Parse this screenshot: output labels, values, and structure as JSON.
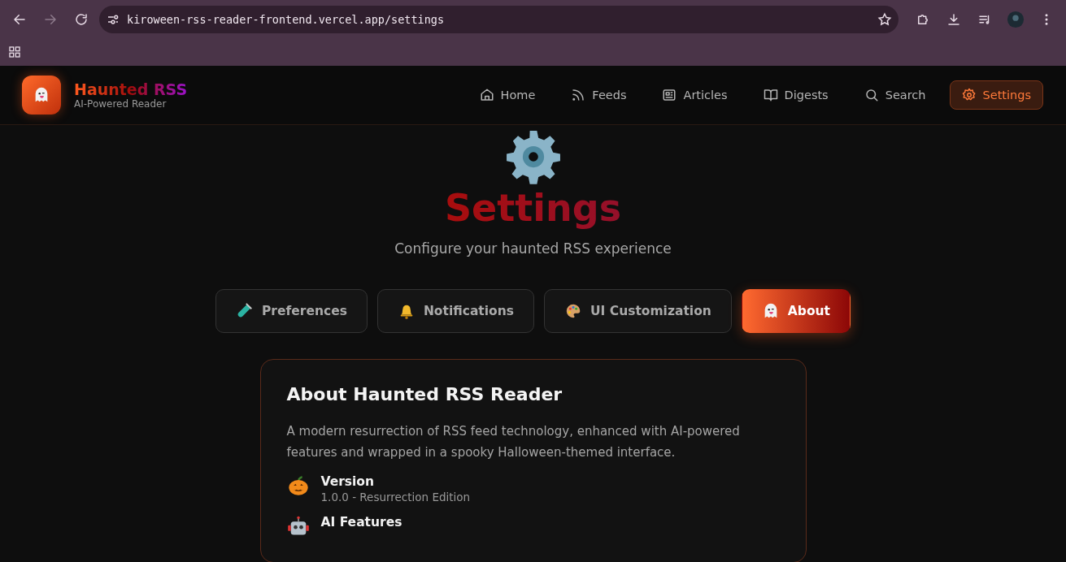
{
  "browser": {
    "url": "kiroween-rss-reader-frontend.vercel.app/settings"
  },
  "header": {
    "brand": "Haunted RSS",
    "tagline": "AI-Powered Reader",
    "nav": [
      {
        "label": "Home",
        "kind": "home",
        "selected": false
      },
      {
        "label": "Feeds",
        "kind": "rss",
        "selected": false
      },
      {
        "label": "Articles",
        "kind": "newspaper",
        "selected": false
      },
      {
        "label": "Digests",
        "kind": "book",
        "selected": false
      },
      {
        "label": "Search",
        "kind": "search",
        "selected": false
      },
      {
        "label": "Settings",
        "kind": "gear",
        "selected": true
      }
    ]
  },
  "page": {
    "title": "Settings",
    "subtitle": "Configure your haunted RSS experience"
  },
  "tabs": [
    {
      "label": "Preferences",
      "kind": "tube",
      "selected": false
    },
    {
      "label": "Notifications",
      "kind": "bell",
      "selected": false
    },
    {
      "label": "UI Customization",
      "kind": "palette",
      "selected": false
    },
    {
      "label": "About",
      "kind": "ghost",
      "selected": true
    }
  ],
  "about": {
    "title": "About Haunted RSS Reader",
    "description": "A modern resurrection of RSS feed technology, enhanced with AI-powered features and wrapped in a spooky Halloween-themed interface.",
    "items": [
      {
        "kind": "pumpkin",
        "label": "Version",
        "detail": "1.0.0 - Resurrection Edition"
      },
      {
        "kind": "robot",
        "label": "AI Features"
      }
    ]
  }
}
